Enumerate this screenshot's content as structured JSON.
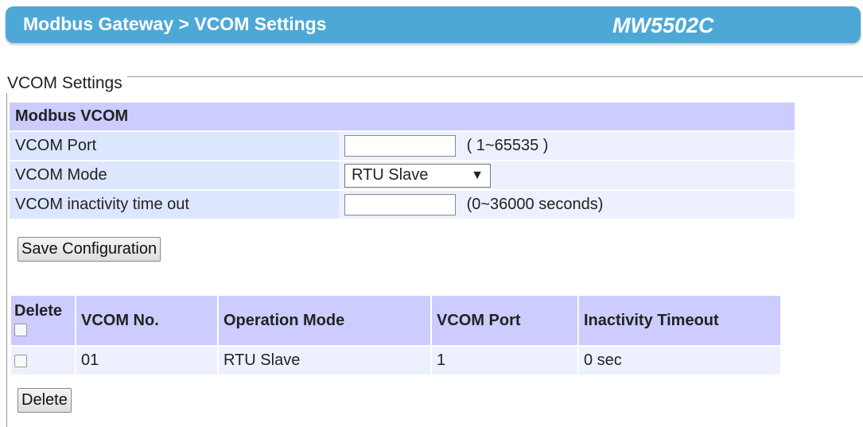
{
  "header": {
    "title": "Modbus Gateway > VCOM Settings",
    "model": "MW5502C"
  },
  "section": {
    "legend": "VCOM Settings"
  },
  "form": {
    "heading": "Modbus VCOM",
    "vcom_port": {
      "label": "VCOM Port",
      "value": "",
      "hint": "( 1~65535 )"
    },
    "vcom_mode": {
      "label": "VCOM Mode",
      "selected": "RTU Slave"
    },
    "inactivity": {
      "label": "VCOM inactivity time out",
      "value": "",
      "hint": "(0~36000 seconds)"
    },
    "save_label": "Save Configuration"
  },
  "list": {
    "columns": [
      "Delete",
      "VCOM No.",
      "Operation Mode",
      "VCOM Port",
      "Inactivity Timeout"
    ],
    "rows": [
      {
        "no": "01",
        "mode": "RTU Slave",
        "port": "1",
        "timeout": "0 sec",
        "checked": false
      }
    ],
    "delete_label": "Delete"
  }
}
